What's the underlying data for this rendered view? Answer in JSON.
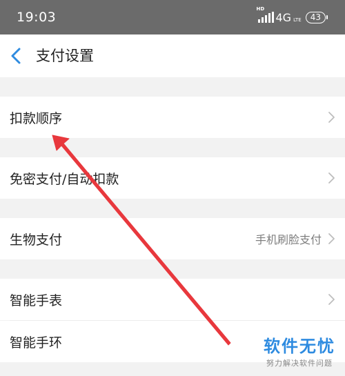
{
  "status_bar": {
    "time": "19:03",
    "hd": "HD",
    "network": "4G",
    "network_sub": "LTE",
    "battery": "43"
  },
  "nav": {
    "title": "支付设置"
  },
  "menu": {
    "deduction_order": "扣款顺序",
    "password_free": "免密支付/自动扣款",
    "biometric": "生物支付",
    "biometric_value": "手机刷脸支付",
    "smart_watch": "智能手表",
    "smart_band": "智能手环"
  },
  "watermark": {
    "title": "软件无忧",
    "subtitle": "努力解决软件问题"
  },
  "colors": {
    "accent": "#2e8be0",
    "arrow": "#e8383d",
    "status_bar_bg": "#6b6b6b",
    "page_bg": "#f2f2f2"
  }
}
